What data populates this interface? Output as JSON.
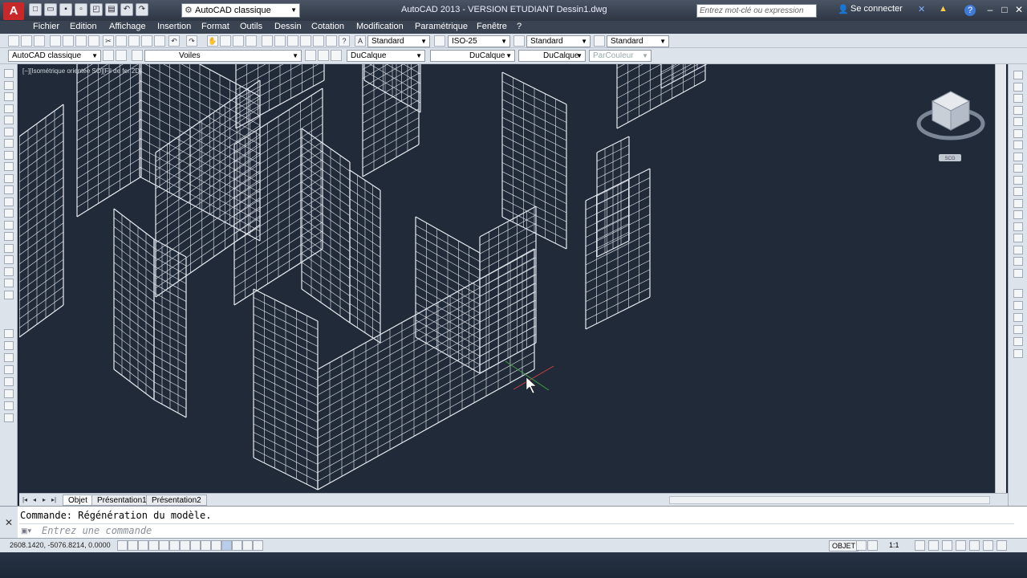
{
  "titlebar": {
    "app_logo": "A",
    "workspace": "AutoCAD classique",
    "title": "AutoCAD 2013 - VERSION ETUDIANT    Dessin1.dwg",
    "search_placeholder": "Entrez mot-clé ou expression",
    "signin": "Se connecter",
    "help": "?"
  },
  "menu": {
    "items": [
      "Fichier",
      "Edition",
      "Affichage",
      "Insertion",
      "Format",
      "Outils",
      "Dessin",
      "Cotation",
      "Modification",
      "Paramétrique",
      "Fenêtre",
      "?"
    ]
  },
  "styles_toolbar": {
    "text_style": "Standard",
    "dim_style": "ISO-25",
    "table_style": "Standard",
    "mleader_style": "Standard"
  },
  "layers_toolbar": {
    "workspace": "AutoCAD classique",
    "layer": "Voiles",
    "color": "DuCalque",
    "linetype": "DuCalque",
    "lineweight": "DuCalque",
    "plotstyle": "ParCouleur"
  },
  "viewport": {
    "label": "[−][Isométrique orientée SO][Fil de fer 2D]",
    "viewcube_label": "SCG"
  },
  "tabs": {
    "items": [
      "Objet",
      "Présentation1",
      "Présentation2"
    ]
  },
  "command": {
    "history": "Commande:  Régénération du modèle.",
    "placeholder": "Entrez une commande"
  },
  "status": {
    "coords": "2608.1420, -5076.8214, 0.0000",
    "model": "OBJET",
    "scale": "1:1"
  },
  "colors": {
    "viewport_bg": "#212a38",
    "wireframe": "#e8ecf2",
    "ui_bg": "#dde3ea",
    "logo_red": "#c8282a"
  }
}
